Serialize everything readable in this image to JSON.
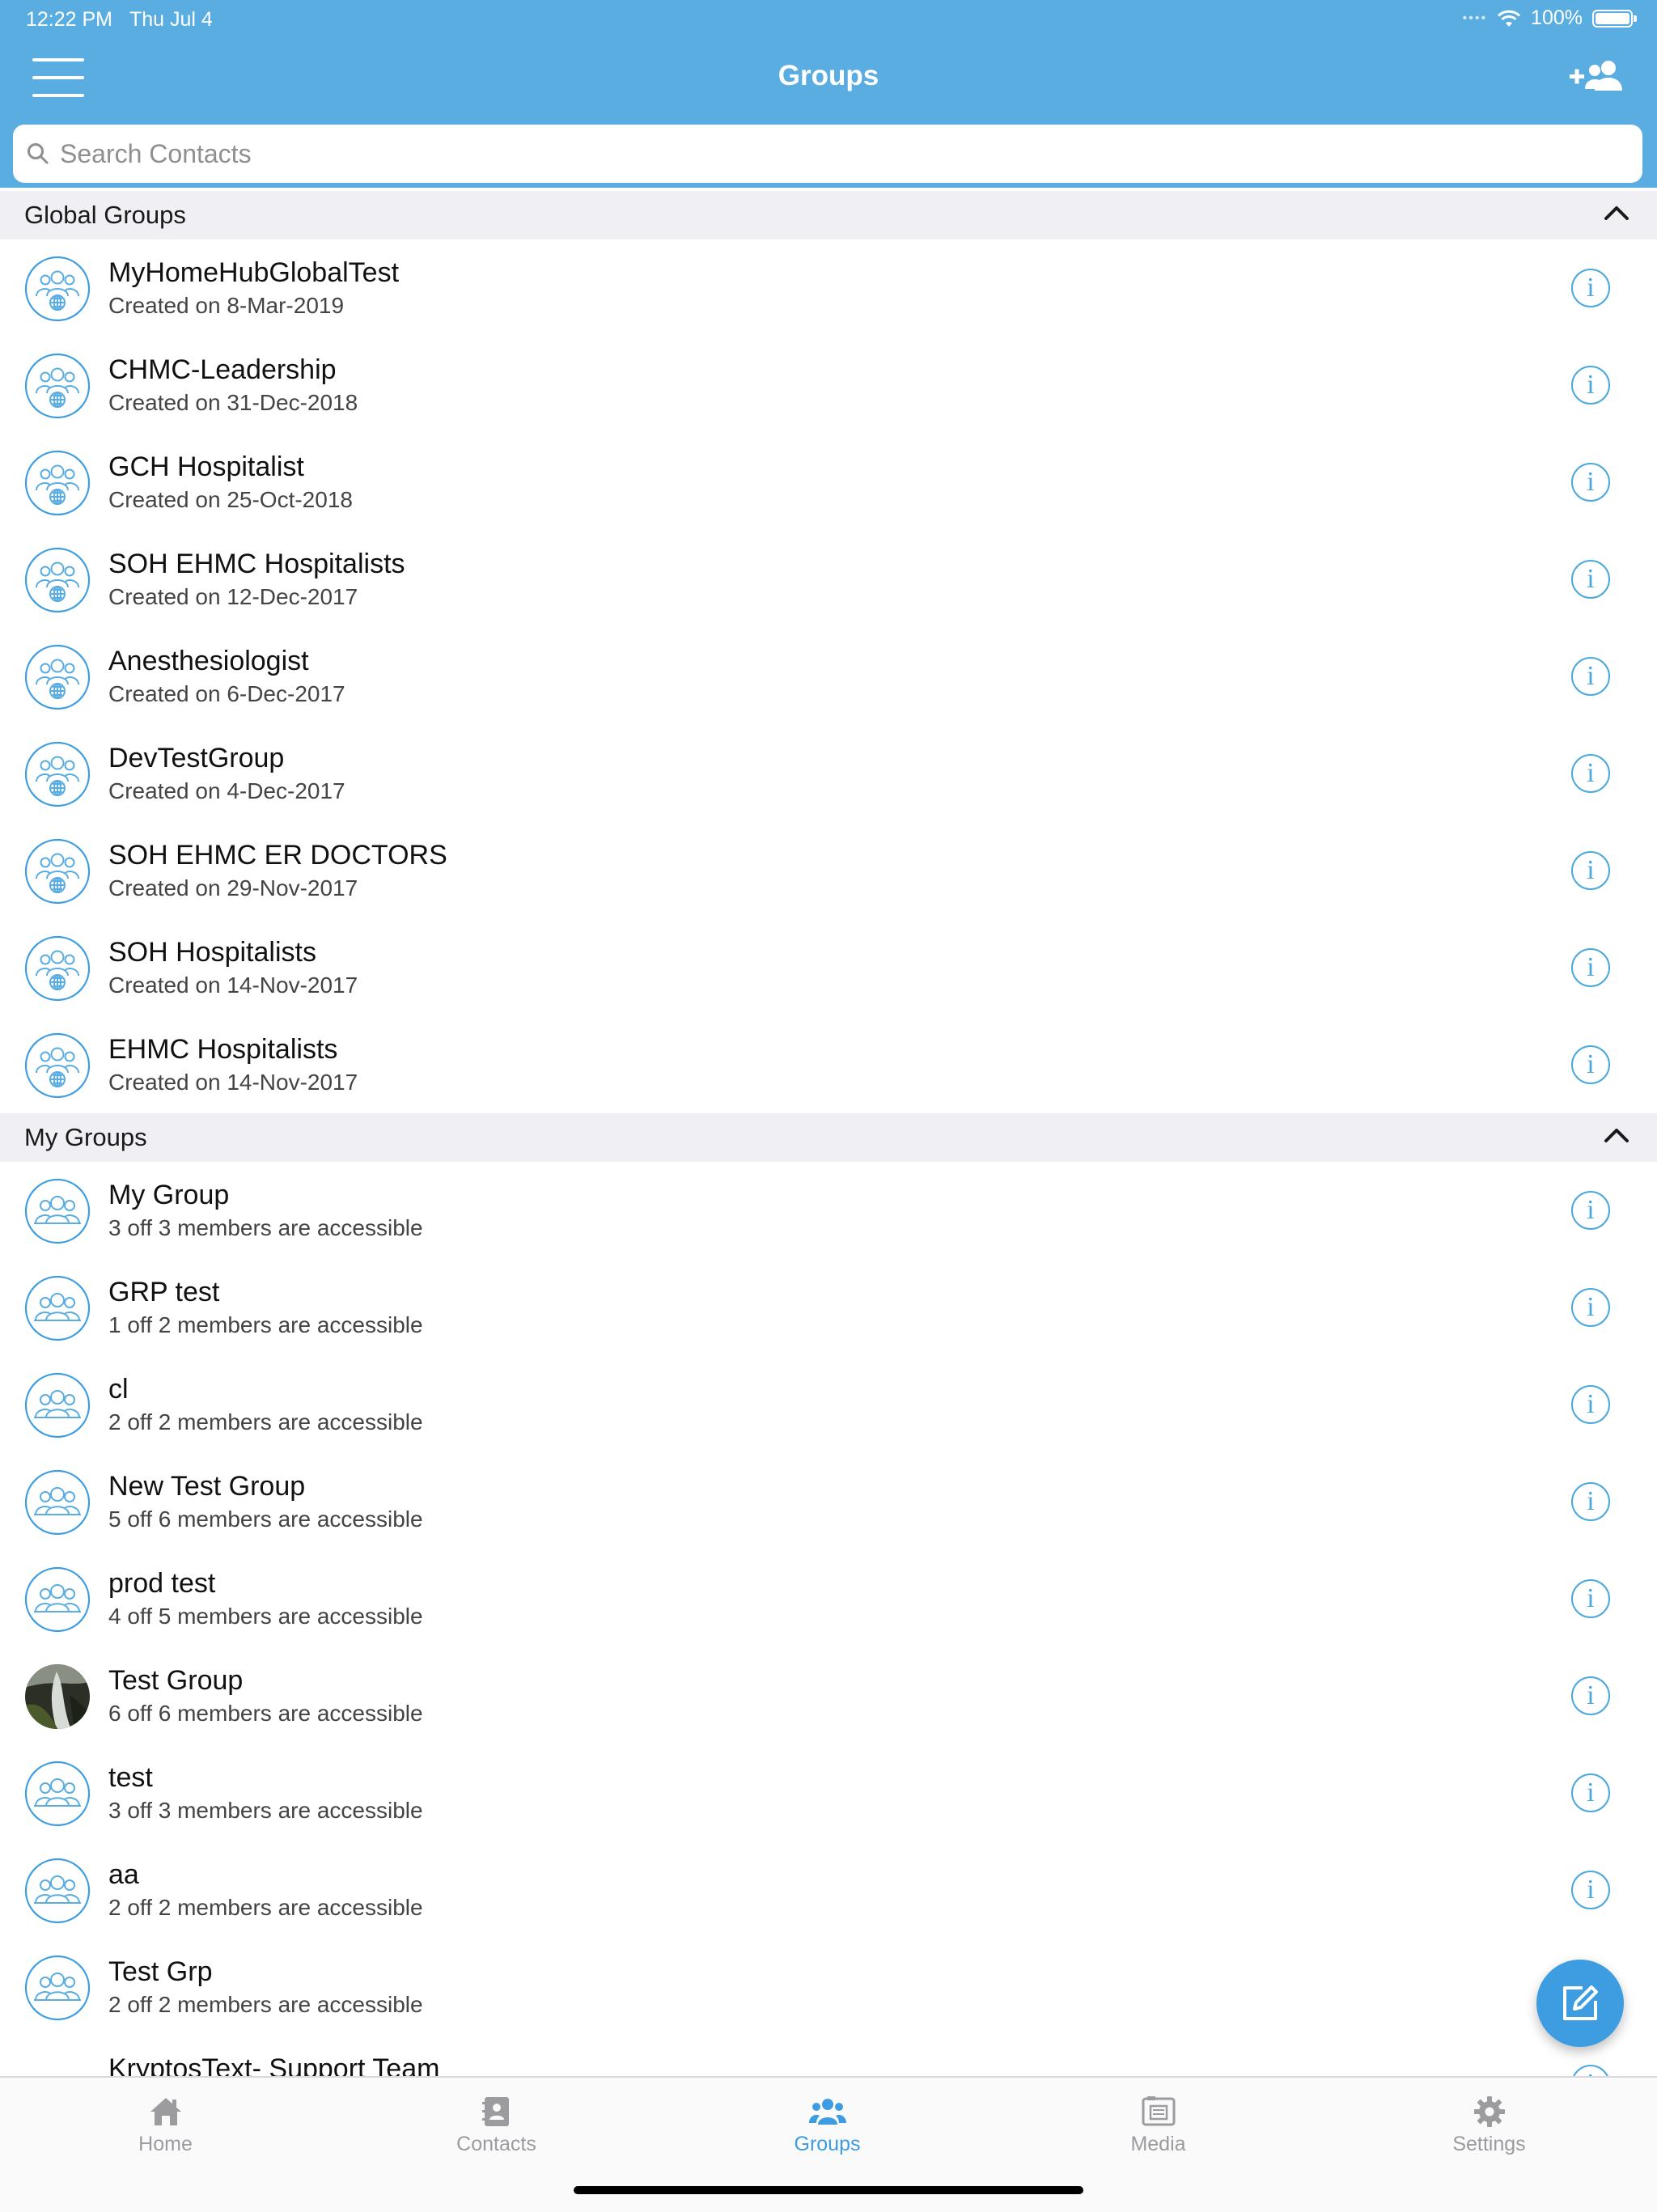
{
  "status_bar": {
    "time": "12:22 PM",
    "date": "Thu Jul 4",
    "battery": "100%"
  },
  "nav": {
    "title": "Groups"
  },
  "search": {
    "placeholder": "Search Contacts"
  },
  "sections": {
    "global": {
      "title": "Global Groups",
      "items": [
        {
          "name": "MyHomeHubGlobalTest",
          "sub": "Created on 8-Mar-2019"
        },
        {
          "name": "CHMC-Leadership",
          "sub": "Created on 31-Dec-2018"
        },
        {
          "name": "GCH Hospitalist",
          "sub": "Created on 25-Oct-2018"
        },
        {
          "name": "SOH EHMC Hospitalists",
          "sub": "Created on 12-Dec-2017"
        },
        {
          "name": "Anesthesiologist",
          "sub": "Created on 6-Dec-2017"
        },
        {
          "name": "DevTestGroup",
          "sub": "Created on 4-Dec-2017"
        },
        {
          "name": "SOH EHMC ER DOCTORS",
          "sub": "Created on 29-Nov-2017"
        },
        {
          "name": "SOH Hospitalists",
          "sub": "Created on 14-Nov-2017"
        },
        {
          "name": "EHMC Hospitalists",
          "sub": "Created on 14-Nov-2017"
        }
      ]
    },
    "mine": {
      "title": "My Groups",
      "items": [
        {
          "name": "My Group",
          "sub": "3 off 3 members are accessible"
        },
        {
          "name": "GRP test",
          "sub": "1 off 2 members are accessible"
        },
        {
          "name": "cl",
          "sub": "2 off 2 members are accessible"
        },
        {
          "name": "New Test Group",
          "sub": "5 off 6 members are accessible"
        },
        {
          "name": "prod test",
          "sub": "4 off 5 members are accessible"
        },
        {
          "name": "Test Group",
          "sub": "6 off 6 members are accessible"
        },
        {
          "name": "test",
          "sub": "3 off 3 members are accessible"
        },
        {
          "name": "aa",
          "sub": "2 off 2 members are accessible"
        },
        {
          "name": "Test Grp",
          "sub": "2 off 2 members are accessible"
        },
        {
          "name": "KryptosText- Support Team",
          "sub": ""
        }
      ]
    }
  },
  "icons": {
    "info": "i"
  },
  "tabs": [
    {
      "label": "Home",
      "icon": "home-icon"
    },
    {
      "label": "Contacts",
      "icon": "contacts-icon"
    },
    {
      "label": "Groups",
      "icon": "groups-icon",
      "active": true
    },
    {
      "label": "Media",
      "icon": "media-icon"
    },
    {
      "label": "Settings",
      "icon": "gear-icon"
    }
  ],
  "colors": {
    "accent": "#5aade0",
    "active_tab": "#3d9de0",
    "info": "#4aa8dd",
    "section_bg": "#efeff4"
  }
}
